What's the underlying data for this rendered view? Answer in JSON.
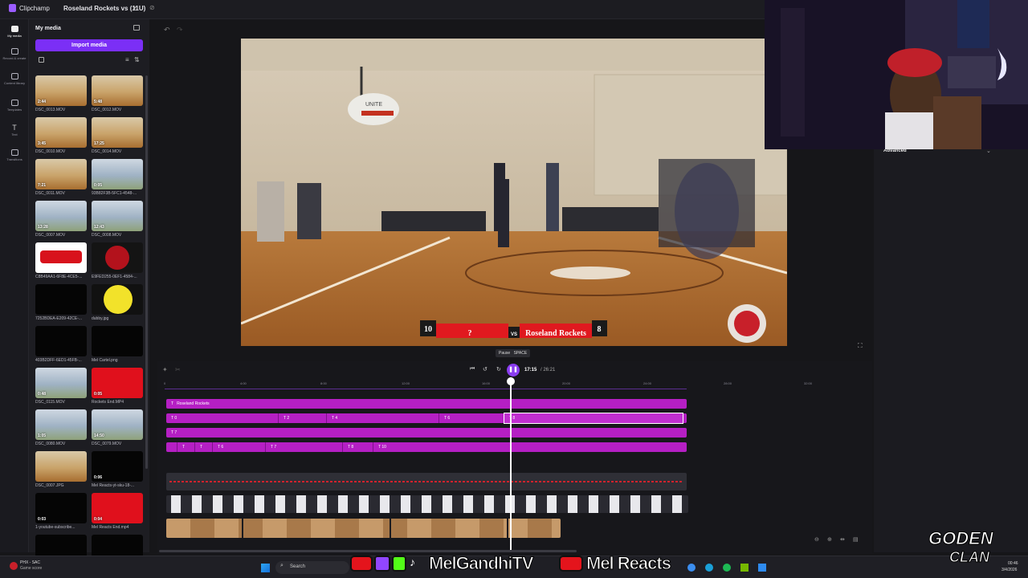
{
  "titlebar": {
    "app_name": "Clipchamp",
    "project_name": "Roseland Rockets vs (11U)"
  },
  "rail": {
    "items": [
      {
        "label": "My media",
        "icon": "folder-icon"
      },
      {
        "label": "Record & create",
        "icon": "camera-icon"
      },
      {
        "label": "Content library",
        "icon": "library-icon"
      },
      {
        "label": "Templates",
        "icon": "templates-icon"
      },
      {
        "label": "Text",
        "icon": "text-icon"
      },
      {
        "label": "Transitions",
        "icon": "transitions-icon"
      }
    ]
  },
  "media": {
    "title": "My media",
    "import_label": "Import media",
    "items": [
      {
        "name": "DSC_0013.MOV",
        "duration": "2:44",
        "kind": "gym"
      },
      {
        "name": "DSC_0012.MOV",
        "duration": "5:48",
        "kind": "gym"
      },
      {
        "name": "DSC_0010.MOV",
        "duration": "3:45",
        "kind": "gym"
      },
      {
        "name": "DSC_0014.MOV",
        "duration": "17:25",
        "kind": "gym"
      },
      {
        "name": "DSC_0011.MOV",
        "duration": "7:21",
        "kind": "gym"
      },
      {
        "name": "93B82F3B-5FC1-4548-...",
        "duration": "0:05",
        "kind": "court"
      },
      {
        "name": "DSC_0007.MOV",
        "duration": "13:28",
        "kind": "court"
      },
      {
        "name": "DSC_0008.MOV",
        "duration": "12:43",
        "kind": "court"
      },
      {
        "name": "C8B49AA1-6F8E-4CE5-...",
        "duration": "",
        "kind": "logo-white"
      },
      {
        "name": "E9FED255-0EF1-4584-...",
        "duration": "",
        "kind": "logo-dark"
      },
      {
        "name": "7252BDEA-E209-42CE-...",
        "duration": "",
        "kind": "black"
      },
      {
        "name": "dubby.jpg",
        "duration": "",
        "kind": "yellow"
      },
      {
        "name": "403B2DFF-6ED1-45FB-...",
        "duration": "",
        "kind": "black"
      },
      {
        "name": "Mel Cartel.png",
        "duration": "",
        "kind": "black"
      },
      {
        "name": "DSC_0115.MOV",
        "duration": "0:48",
        "kind": "court"
      },
      {
        "name": "Rockets End.MP4",
        "duration": "0:05",
        "kind": "red"
      },
      {
        "name": "DSC_0080.MOV",
        "duration": "1:05",
        "kind": "court"
      },
      {
        "name": "DSC_0079.MOV",
        "duration": "14:50",
        "kind": "court"
      },
      {
        "name": "DSC_0007.JPG",
        "duration": "",
        "kind": "gym"
      },
      {
        "name": "Mel Reacts-yt-sku-18-...",
        "duration": "0:06",
        "kind": "black"
      },
      {
        "name": "1-youtube-subscribe...",
        "duration": "0:03",
        "kind": "black"
      },
      {
        "name": "Mel Reacts End.mp4",
        "duration": "0:04",
        "kind": "red"
      },
      {
        "name": "",
        "duration": "0:05",
        "kind": "black"
      },
      {
        "name": "",
        "duration": "",
        "kind": "black"
      }
    ]
  },
  "preview": {
    "score_left": "10",
    "score_right": "8",
    "team_left": "?",
    "vs": "VS",
    "team_right": "Roseland Rockets",
    "court_text": "UNITE",
    "pause_tip": "Pause",
    "pause_key": "SPACE"
  },
  "timeline": {
    "current_time": "17:15",
    "total_time": "/ 26:21",
    "ruler": [
      "0",
      "4:00",
      "8:00",
      "12:00",
      "16:00",
      "20:00",
      "24:00",
      "28:00",
      "32:00"
    ],
    "text_track_1": "Roseland Rockets",
    "text_track_2": [
      {
        "label": "0"
      },
      {
        "label": "2"
      },
      {
        "label": "4"
      },
      {
        "label": "6"
      },
      {
        "label": "8"
      }
    ],
    "text_track_3": [
      {
        "label": "7"
      }
    ],
    "text_track_4": [
      {
        "label": ""
      },
      {
        "label": ""
      },
      {
        "label": ""
      },
      {
        "label": "6"
      },
      {
        "label": "7"
      },
      {
        "label": "8"
      },
      {
        "label": "10"
      }
    ]
  },
  "right_panel": {
    "advanced_label": "Advanced"
  },
  "taskbar": {
    "weather_line1": "PHX - SAC",
    "weather_line2": "Game score",
    "search_label": "Search",
    "time": "00:46",
    "date": "3/4/2026"
  },
  "overlay": {
    "channel1": "MelGandhiTV",
    "channel2": "Mel Reacts",
    "watermark_top": "GODEN",
    "watermark_bottom": "CLAN"
  },
  "colors": {
    "accent": "#7b2ff6",
    "clip": "#b51fc4",
    "score_red": "#e0191f"
  }
}
